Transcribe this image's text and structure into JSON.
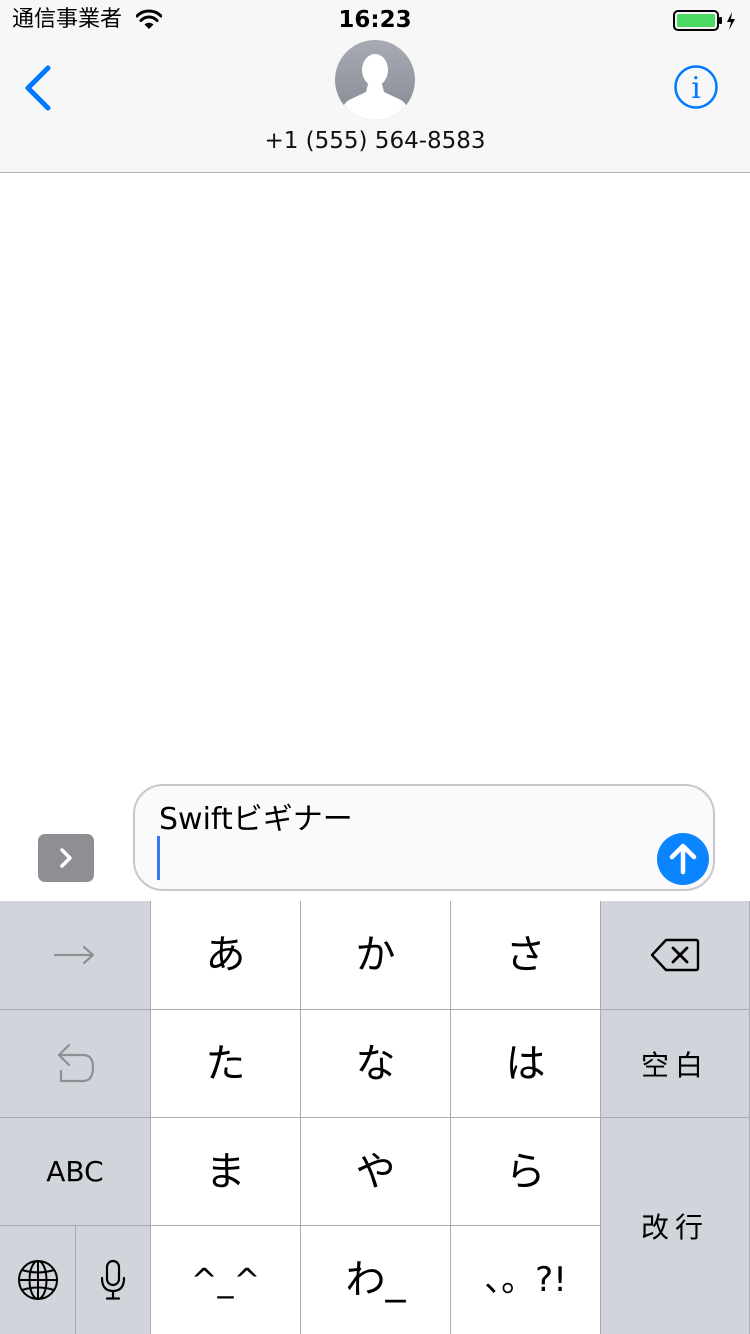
{
  "status_bar": {
    "carrier": "通信事業者",
    "time": "16:23",
    "battery_color": "#4cd964"
  },
  "header": {
    "contact_number": "+1 (555) 564-8583",
    "accent_color": "#007aff",
    "back_icon": "chevron-left-icon",
    "info_icon": "info-icon",
    "avatar_icon": "person-silhouette-icon"
  },
  "composer": {
    "message_text": "Swiftビギナー",
    "apps_icon": "chevron-right-icon",
    "send_icon": "arrow-up-icon"
  },
  "keyboard": {
    "rows": [
      [
        "→",
        "あ",
        "か",
        "さ",
        "⌫"
      ],
      [
        "↩",
        "た",
        "な",
        "は",
        "空白"
      ],
      [
        "ABC",
        "ま",
        "や",
        "ら",
        "改行"
      ],
      [
        "🌐",
        "🎤",
        "^^",
        "わ",
        "、。?!"
      ]
    ],
    "keys": {
      "a": "あ",
      "ka": "か",
      "sa": "さ",
      "ta": "た",
      "na": "な",
      "ha": "は",
      "ma": "ま",
      "ya": "や",
      "ra": "ら",
      "emoticon": "^_^",
      "wa": "わ_",
      "punctuation": "、。?!",
      "abc": "ABC",
      "space": "空白",
      "return": "改行"
    }
  }
}
